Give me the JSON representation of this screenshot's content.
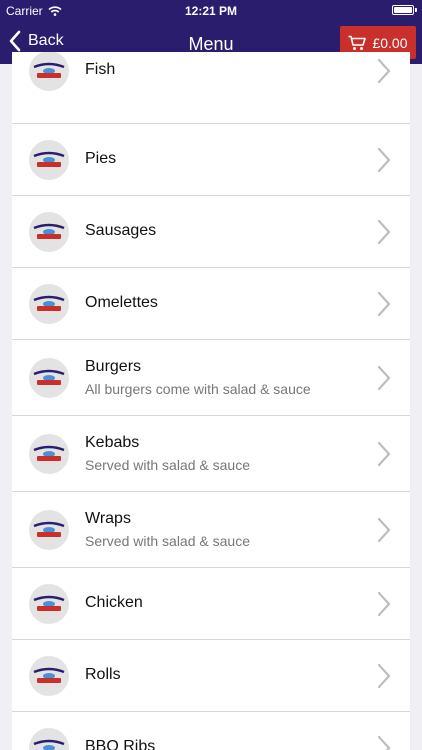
{
  "status_bar": {
    "carrier": "Carrier",
    "time": "12:21 PM"
  },
  "nav": {
    "back_label": "Back",
    "title": "Menu",
    "cart_total": "£0.00"
  },
  "colors": {
    "nav_background": "#2b1d6e",
    "cart_button": "#c9302c",
    "chevron": "#bdbdbd",
    "subtitle_text": "#777777"
  },
  "icons": {
    "back": "chevron-left-icon",
    "cart": "shopping-cart-icon",
    "item_logo": "navyy-fish-bar-logo-icon",
    "row_disclosure": "chevron-right-icon"
  },
  "menu": {
    "items": [
      {
        "title": "Fish",
        "subtitle": ""
      },
      {
        "title": "Pies",
        "subtitle": ""
      },
      {
        "title": "Sausages",
        "subtitle": ""
      },
      {
        "title": "Omelettes",
        "subtitle": ""
      },
      {
        "title": "Burgers",
        "subtitle": "All burgers come with salad & sauce"
      },
      {
        "title": "Kebabs",
        "subtitle": "Served with salad & sauce"
      },
      {
        "title": "Wraps",
        "subtitle": "Served with salad & sauce"
      },
      {
        "title": "Chicken",
        "subtitle": ""
      },
      {
        "title": "Rolls",
        "subtitle": ""
      },
      {
        "title": "BBQ Ribs",
        "subtitle": ""
      }
    ]
  }
}
